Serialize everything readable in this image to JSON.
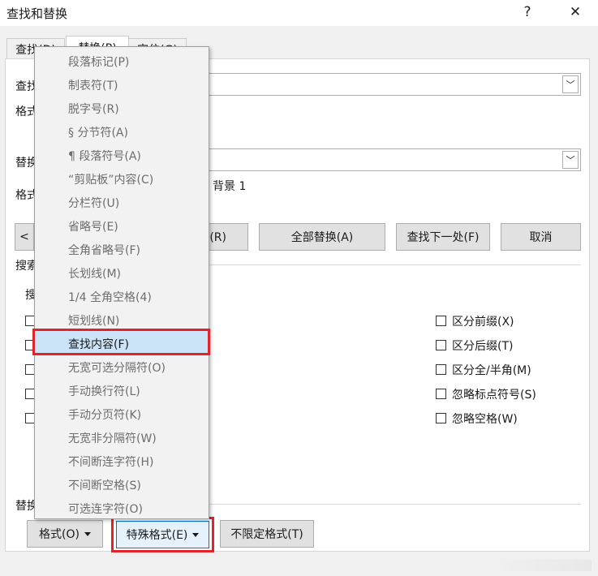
{
  "window": {
    "title": "查找和替换",
    "help": "?",
    "close": "✕"
  },
  "tabs": [
    {
      "label": "查找(D)"
    },
    {
      "label": "替换(P)"
    },
    {
      "label": "定位(G)"
    }
  ],
  "find": {
    "label": "查找",
    "format_label": "格式"
  },
  "replace": {
    "label": "替换",
    "format_label": "格式",
    "format_value": "背景 1"
  },
  "buttons": {
    "more": "<",
    "replace": "替换(R)",
    "replace_all": "全部替换(A)",
    "find_next": "查找下一处(F)",
    "cancel": "取消"
  },
  "search_options": {
    "section": "搜索",
    "search_label": "搜"
  },
  "checkboxes_right": [
    {
      "label": "区分前缀(X)"
    },
    {
      "label": "区分后缀(T)"
    },
    {
      "label": "区分全/半角(M)"
    },
    {
      "label": "忽略标点符号(S)"
    },
    {
      "label": "忽略空格(W)"
    }
  ],
  "replace_section": {
    "label": "替换"
  },
  "bottom_buttons": {
    "format": "格式(O)",
    "special": "特殊格式(E)",
    "no_format": "不限定格式(T)"
  },
  "special_menu": [
    {
      "label": "段落标记(P)"
    },
    {
      "label": "制表符(T)"
    },
    {
      "label": "脱字号(R)"
    },
    {
      "label": "§ 分节符(A)"
    },
    {
      "label": "¶ 段落符号(A)"
    },
    {
      "label": "“剪贴板”内容(C)"
    },
    {
      "label": "分栏符(U)"
    },
    {
      "label": "省略号(E)"
    },
    {
      "label": "全角省略号(F)"
    },
    {
      "label": "长划线(M)"
    },
    {
      "label": "1/4 全角空格(4)"
    },
    {
      "label": "短划线(N)"
    },
    {
      "label": "查找内容(F)"
    },
    {
      "label": "无宽可选分隔符(O)"
    },
    {
      "label": "手动换行符(L)"
    },
    {
      "label": "手动分页符(K)"
    },
    {
      "label": "无宽非分隔符(W)"
    },
    {
      "label": "不间断连字符(H)"
    },
    {
      "label": "不间断空格(S)"
    },
    {
      "label": "可选连字符(O)"
    }
  ],
  "colors": {
    "highlight": "#cce4f7",
    "annotation_red": "#e2232a"
  }
}
